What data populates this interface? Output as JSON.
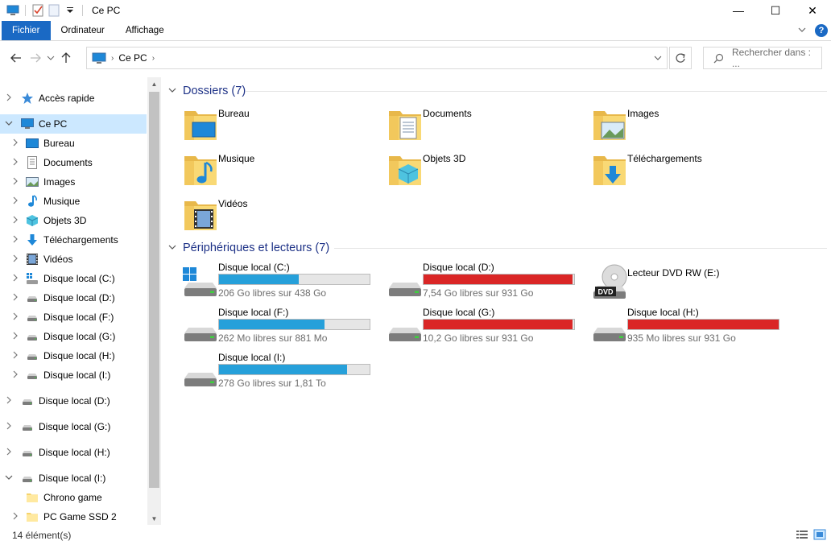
{
  "window": {
    "title": "Ce PC",
    "controls": {
      "minimize": "—",
      "maximize": "☐",
      "close": "✕"
    }
  },
  "ribbon": {
    "tabs": [
      "Fichier",
      "Ordinateur",
      "Affichage"
    ],
    "help": "?"
  },
  "address": {
    "path": [
      "Ce PC"
    ],
    "search_placeholder": "Rechercher dans : ..."
  },
  "nav_pane": {
    "items": [
      {
        "label": "Accès rapide",
        "icon": "star-icon",
        "indent": 0,
        "expanded": false
      },
      {
        "label": "Ce PC",
        "icon": "computer-icon",
        "indent": 0,
        "expanded": true,
        "selected": true
      },
      {
        "label": "Bureau",
        "icon": "desktop-icon",
        "indent": 1,
        "expanded": false
      },
      {
        "label": "Documents",
        "icon": "documents-icon",
        "indent": 1,
        "expanded": false
      },
      {
        "label": "Images",
        "icon": "pictures-icon",
        "indent": 1,
        "expanded": false
      },
      {
        "label": "Musique",
        "icon": "music-icon",
        "indent": 1,
        "expanded": false
      },
      {
        "label": "Objets 3D",
        "icon": "3d-objects-icon",
        "indent": 1,
        "expanded": false
      },
      {
        "label": "Téléchargements",
        "icon": "downloads-icon",
        "indent": 1,
        "expanded": false
      },
      {
        "label": "Vidéos",
        "icon": "videos-icon",
        "indent": 1,
        "expanded": false
      },
      {
        "label": "Disque local (C:)",
        "icon": "windows-drive-icon",
        "indent": 1,
        "expanded": false
      },
      {
        "label": "Disque local (D:)",
        "icon": "drive-icon",
        "indent": 1,
        "expanded": false
      },
      {
        "label": "Disque local (F:)",
        "icon": "drive-icon",
        "indent": 1,
        "expanded": false
      },
      {
        "label": "Disque local (G:)",
        "icon": "drive-icon",
        "indent": 1,
        "expanded": false
      },
      {
        "label": "Disque local (H:)",
        "icon": "drive-icon",
        "indent": 1,
        "expanded": false
      },
      {
        "label": "Disque local (I:)",
        "icon": "drive-icon",
        "indent": 1,
        "expanded": false
      },
      {
        "label": "Disque local (D:)",
        "icon": "drive-icon",
        "indent": 0,
        "expanded": false
      },
      {
        "label": "Disque local (G:)",
        "icon": "drive-icon",
        "indent": 0,
        "expanded": false
      },
      {
        "label": "Disque local (H:)",
        "icon": "drive-icon",
        "indent": 0,
        "expanded": false
      },
      {
        "label": "Disque local (I:)",
        "icon": "drive-icon",
        "indent": 0,
        "expanded": true
      },
      {
        "label": "Chrono game",
        "icon": "folder-icon",
        "indent": 1,
        "expanded": null
      },
      {
        "label": "PC Game SSD 2",
        "icon": "folder-icon",
        "indent": 1,
        "expanded": false
      }
    ]
  },
  "content": {
    "folders_header": "Dossiers (7)",
    "folders": [
      {
        "name": "Bureau",
        "icon": "desktop-folder-icon"
      },
      {
        "name": "Documents",
        "icon": "documents-folder-icon"
      },
      {
        "name": "Images",
        "icon": "pictures-folder-icon"
      },
      {
        "name": "Musique",
        "icon": "music-folder-icon"
      },
      {
        "name": "Objets 3D",
        "icon": "3d-objects-folder-icon"
      },
      {
        "name": "Téléchargements",
        "icon": "downloads-folder-icon"
      },
      {
        "name": "Vidéos",
        "icon": "videos-folder-icon"
      }
    ],
    "devices_header": "Périphériques et lecteurs (7)",
    "devices": [
      {
        "name": "Disque local (C:)",
        "free": "206 Go libres sur 438 Go",
        "used_fraction": 0.53,
        "bar_color": "#26a0da",
        "icon": "windows-drive-icon"
      },
      {
        "name": "Disque local (D:)",
        "free": "7,54 Go libres sur 931 Go",
        "used_fraction": 0.99,
        "bar_color": "#da2626",
        "icon": "drive-icon"
      },
      {
        "name": "Lecteur DVD RW (E:)",
        "free": "",
        "used_fraction": null,
        "bar_color": "",
        "icon": "dvd-drive-icon"
      },
      {
        "name": "Disque local (F:)",
        "free": "262 Mo libres sur 881 Mo",
        "used_fraction": 0.7,
        "bar_color": "#26a0da",
        "icon": "drive-icon"
      },
      {
        "name": "Disque local (G:)",
        "free": "10,2 Go libres sur 931 Go",
        "used_fraction": 0.99,
        "bar_color": "#da2626",
        "icon": "drive-icon"
      },
      {
        "name": "Disque local (H:)",
        "free": "935 Mo libres sur 931 Go",
        "used_fraction": 0.999,
        "bar_color": "#da2626",
        "icon": "drive-icon"
      },
      {
        "name": "Disque local (I:)",
        "free": "278 Go libres sur 1,81 To",
        "used_fraction": 0.85,
        "bar_color": "#26a0da",
        "icon": "drive-icon"
      }
    ]
  },
  "status": {
    "count": "14 élément(s)"
  }
}
